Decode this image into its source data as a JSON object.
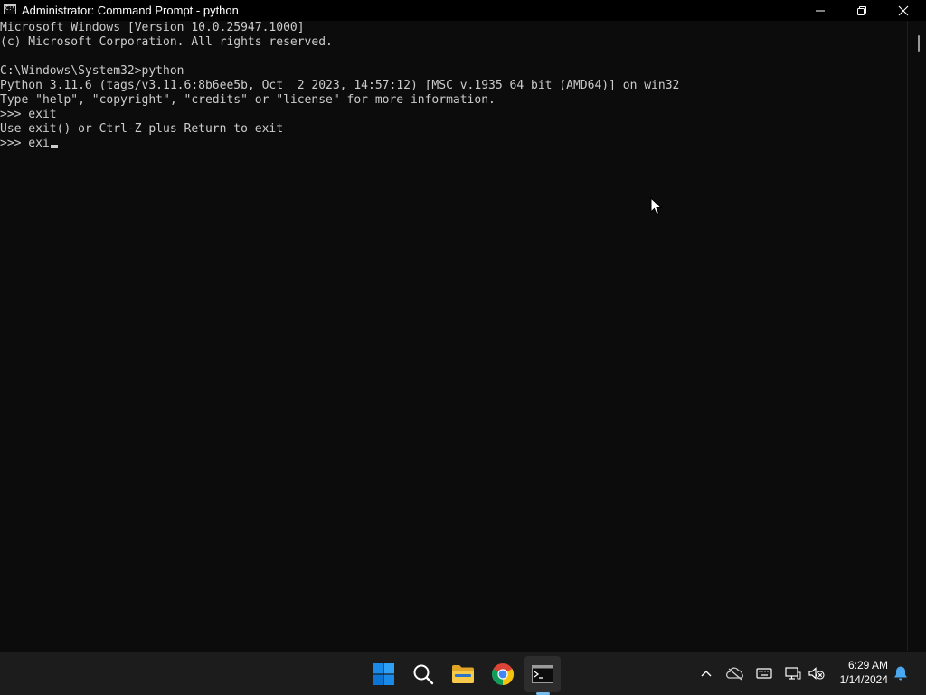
{
  "window": {
    "title": "Administrator: Command Prompt - python",
    "icon_text": "C:\\_"
  },
  "console": {
    "lines": [
      "Microsoft Windows [Version 10.0.25947.1000]",
      "(c) Microsoft Corporation. All rights reserved.",
      "",
      "C:\\Windows\\System32>python",
      "Python 3.11.6 (tags/v3.11.6:8b6ee5b, Oct  2 2023, 14:57:12) [MSC v.1935 64 bit (AMD64)] on win32",
      "Type \"help\", \"copyright\", \"credits\" or \"license\" for more information.",
      ">>> exit",
      "Use exit() or Ctrl-Z plus Return to exit",
      ">>> exi"
    ],
    "text_color": "#cccccc",
    "background": "#0c0c0c"
  },
  "taskbar": {
    "apps": [
      {
        "name": "start",
        "icon": "windows-logo-icon"
      },
      {
        "name": "search",
        "icon": "search-icon"
      },
      {
        "name": "file-explorer",
        "icon": "folder-icon"
      },
      {
        "name": "chrome",
        "icon": "chrome-icon"
      },
      {
        "name": "command-prompt",
        "icon": "terminal-icon",
        "active": true
      }
    ],
    "tray": {
      "icons": [
        "chevron-up-icon",
        "onedrive-icon",
        "keyboard-icon",
        "network-icon",
        "volume-muted-icon",
        "bell-icon"
      ],
      "time": "6:29 AM",
      "date": "1/14/2024"
    }
  }
}
